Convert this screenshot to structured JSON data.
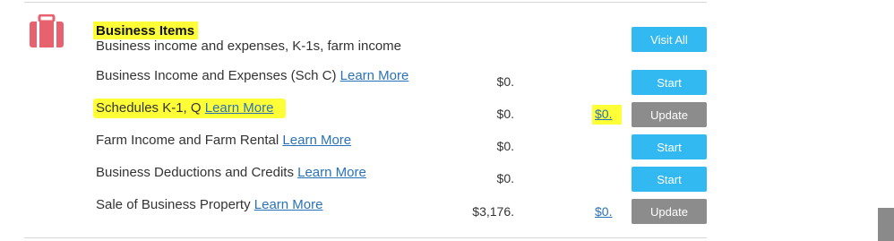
{
  "section": {
    "title": "Business Items",
    "subtitle": "Business income and expenses, K-1s, farm income",
    "visit_all_label": "Visit All",
    "icon": "briefcase-icon",
    "icon_color": "#e8616f",
    "highlight_color": "#ffff38"
  },
  "rows": [
    {
      "label": "Business Income and Expenses (Sch C)",
      "learn_more": "Learn More",
      "amount": "$0.",
      "refund": "",
      "action": "Start"
    },
    {
      "label": "Schedules K-1, Q",
      "learn_more": "Learn More",
      "amount": "$0.",
      "refund": "$0.",
      "action": "Update"
    },
    {
      "label": "Farm Income and Farm Rental",
      "learn_more": "Learn More",
      "amount": "$0.",
      "refund": "",
      "action": "Start"
    },
    {
      "label": "Business Deductions and Credits",
      "learn_more": "Learn More",
      "amount": "$0.",
      "refund": "",
      "action": "Start"
    },
    {
      "label": "Sale of Business Property",
      "learn_more": "Learn More",
      "amount": "$3,176.",
      "refund": "$0.",
      "action": "Update"
    }
  ],
  "colors": {
    "start_button": "#33b9f2",
    "update_button": "#8c8c8c",
    "link": "#2a72b8"
  }
}
